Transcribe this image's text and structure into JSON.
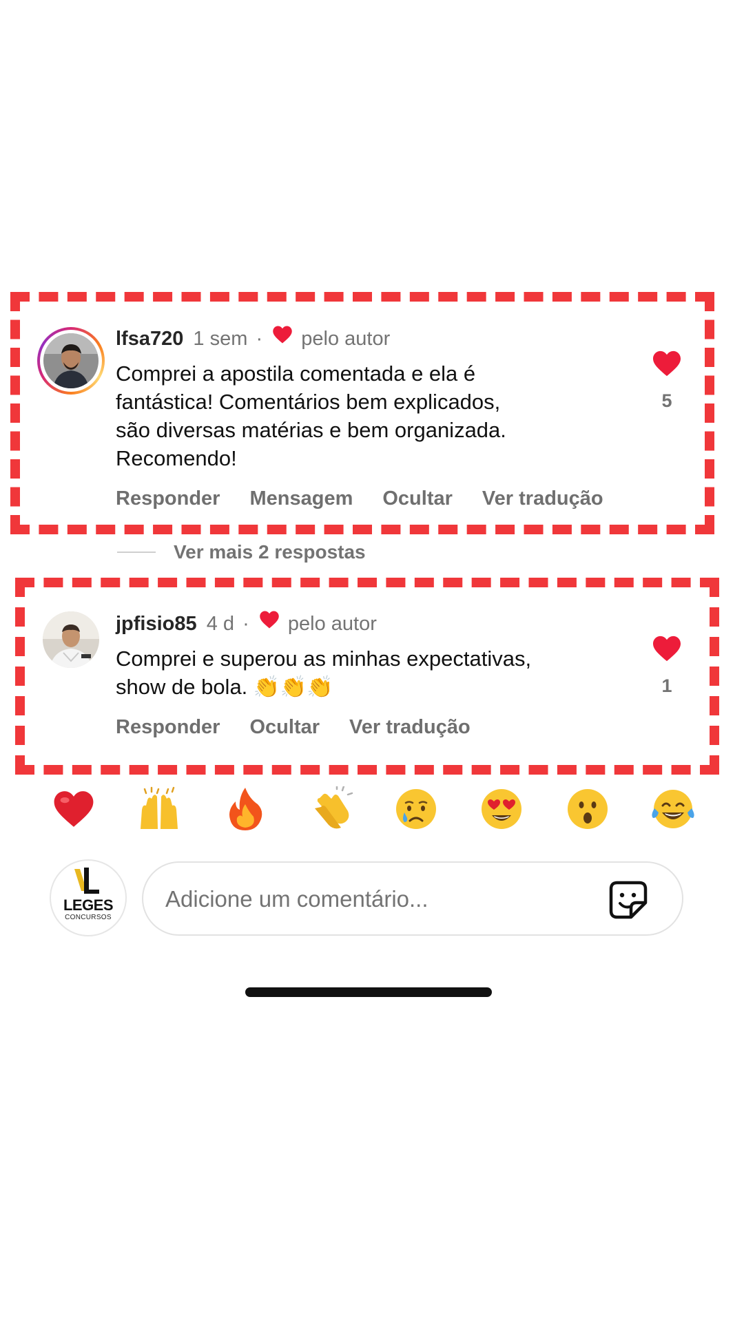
{
  "comments": [
    {
      "username": "lfsa720",
      "time": "1 sem",
      "separator": "·",
      "liked_by_author": "pelo autor",
      "text": "Comprei a apostila comentada e ela é\nfantástica! Comentários bem explicados,\nsão diversas matérias e bem organizada.\nRecomendo!",
      "likes": "5",
      "actions": [
        "Responder",
        "Mensagem",
        "Ocultar",
        "Ver tradução"
      ]
    },
    {
      "username": "jpfisio85",
      "time": "4 d",
      "separator": "·",
      "liked_by_author": "pelo autor",
      "text": "Comprei e superou as minhas expectativas,\nshow de bola. 👏👏👏",
      "likes": "1",
      "actions": [
        "Responder",
        "Ocultar",
        "Ver tradução"
      ]
    }
  ],
  "more_replies": "Ver mais 2 respostas",
  "quick_reactions": [
    "heart-emoji",
    "raised-hands-emoji",
    "fire-emoji",
    "clapping-hands-emoji",
    "crying-face-emoji",
    "heart-eyes-emoji",
    "surprised-face-emoji",
    "tears-of-joy-emoji"
  ],
  "composer": {
    "placeholder": "Adicione um comentário...",
    "avatar_brand": "LEGES",
    "avatar_brand_sub": "CONCURSOS"
  },
  "colors": {
    "highlight": "#f0373a",
    "like_heart": "#ed1c3a",
    "muted_text": "#737373"
  }
}
